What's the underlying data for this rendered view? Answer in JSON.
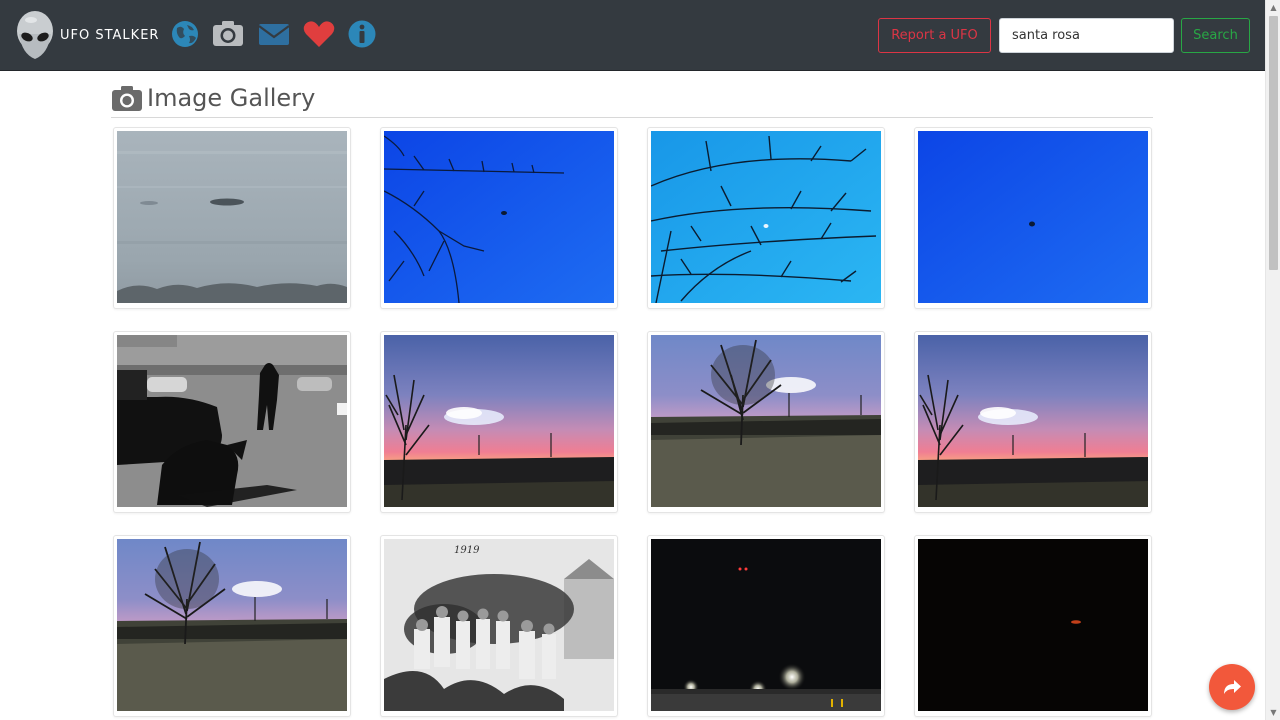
{
  "navbar": {
    "brand": "UFO STALKER",
    "icons": [
      "globe-icon",
      "camera-icon",
      "envelope-icon",
      "heart-icon",
      "info-icon"
    ],
    "report_button": "Report a UFO",
    "search_value": "santa rosa",
    "search_button": "Search"
  },
  "page": {
    "heading": "Image Gallery"
  },
  "gallery": {
    "rows": 3,
    "columns": 4,
    "images": [
      "blurry-ufo-grey-sky",
      "ufo-blue-sky-branches",
      "blue-sky-tree-branches",
      "ufo-dot-blue-sky",
      "bw-people-parking-lot",
      "sunset-tree-clouds",
      "sunset-bare-tree-field",
      "sunset-tree-clouds",
      "sunset-bare-tree-field",
      "vintage-bw-group-photo",
      "night-lights-parking-lot",
      "dark-night-red-light"
    ]
  },
  "colors": {
    "navbar_bg": "#343a40",
    "report_red": "#dc3545",
    "search_green": "#28a745",
    "share_orange": "#f2583b",
    "globe_blue": "#2c87b8",
    "envelope_blue": "#2e6fa0",
    "heart_red": "#e03e3e"
  },
  "share_button_icon": "share-arrow-icon"
}
